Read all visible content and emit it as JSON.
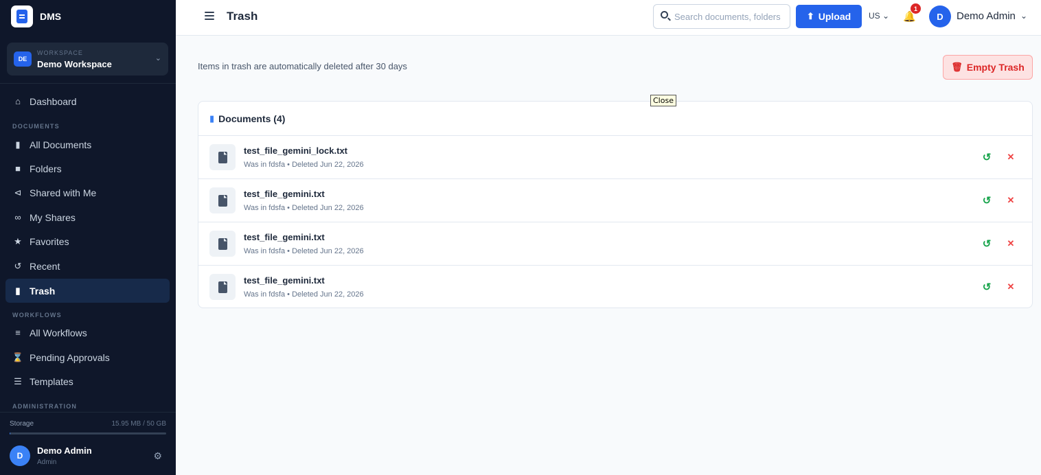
{
  "brand": {
    "name": "DMS"
  },
  "workspace": {
    "small_label": "WORKSPACE",
    "badge": "DE",
    "name": "Demo Workspace"
  },
  "sidebar": {
    "dashboard": "Dashboard",
    "section_documents": "DOCUMENTS",
    "all_documents": "All Documents",
    "folders": "Folders",
    "shared_with_me": "Shared with Me",
    "my_shares": "My Shares",
    "favorites": "Favorites",
    "recent": "Recent",
    "trash": "Trash",
    "section_workflows": "WORKFLOWS",
    "all_workflows": "All Workflows",
    "pending_approvals": "Pending Approvals",
    "templates": "Templates",
    "section_administration": "ADMINISTRATION"
  },
  "storage": {
    "label": "Storage",
    "value": "15.95 MB / 50 GB",
    "fraction_used": 0.0003
  },
  "sidebar_user": {
    "initial": "D",
    "name": "Demo Admin",
    "role": "Admin"
  },
  "topbar": {
    "title": "Trash",
    "search_placeholder": "Search documents, folders",
    "upload_label": "Upload",
    "lang": "US",
    "notification_count": "1",
    "user_initial": "D",
    "user_name": "Demo Admin"
  },
  "main": {
    "notice": "Items in trash are automatically deleted after 30 days",
    "empty_trash_label": "Empty Trash",
    "tooltip": "Close",
    "card_title": "Documents (4)",
    "documents": [
      {
        "name": "test_file_gemini_lock.txt",
        "meta": "Was in fdsfa • Deleted Jun 22, 2026"
      },
      {
        "name": "test_file_gemini.txt",
        "meta": "Was in fdsfa • Deleted Jun 22, 2026"
      },
      {
        "name": "test_file_gemini.txt",
        "meta": "Was in fdsfa • Deleted Jun 22, 2026"
      },
      {
        "name": "test_file_gemini.txt",
        "meta": "Was in fdsfa • Deleted Jun 22, 2026"
      }
    ]
  },
  "colors": {
    "sidebar_bg": "#0f172a",
    "accent": "#2563eb",
    "danger": "#dc2626",
    "restore": "#16a34a"
  }
}
